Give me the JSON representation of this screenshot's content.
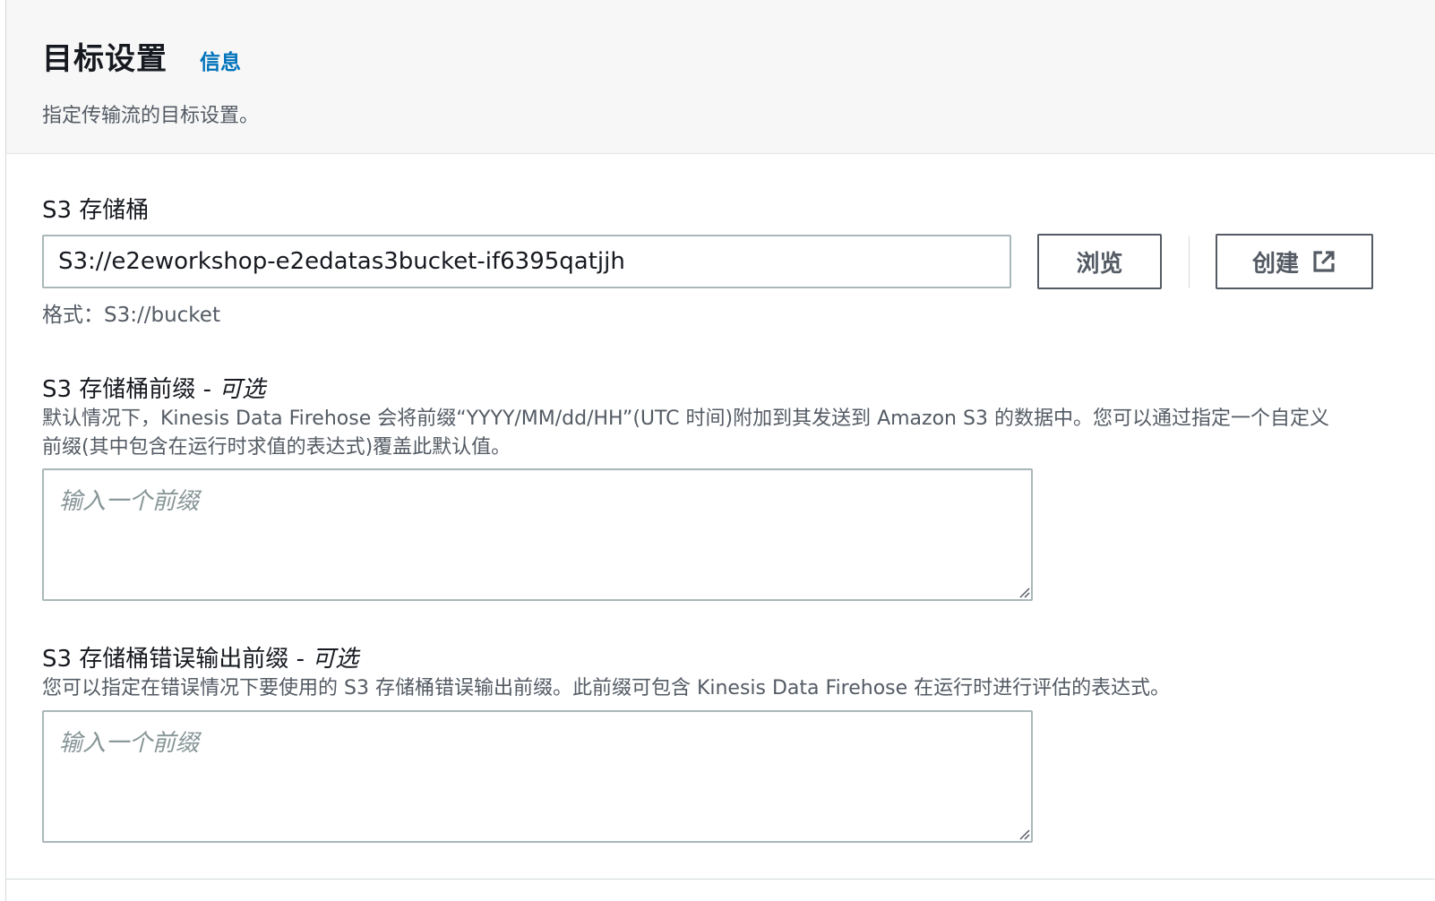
{
  "header": {
    "title": "目标设置",
    "info_link": "信息",
    "description": "指定传输流的目标设置。"
  },
  "bucket": {
    "label": "S3 存储桶",
    "value": "S3://e2eworkshop-e2edatas3bucket-if6395qatjjh",
    "browse_label": "浏览",
    "create_label": "创建",
    "create_icon": "external-link-icon",
    "format_hint": "格式：S3://bucket"
  },
  "prefix": {
    "label": "S3 存储桶前缀 - ",
    "optional": "可选",
    "help_line1": "默认情况下，Kinesis Data Firehose 会将前缀“YYYY/MM/dd/HH”(UTC 时间)附加到其发送到 Amazon S3 的数据中。您可以通过指定一个自定义",
    "help_line2": "前缀(其中包含在运行时求值的表达式)覆盖此默认值。",
    "placeholder": "输入一个前缀"
  },
  "error_prefix": {
    "label": "S3 存储桶错误输出前缀 - ",
    "optional": "可选",
    "help": "您可以指定在错误情况下要使用的 S3 存储桶错误输出前缀。此前缀可包含 Kinesis Data Firehose 在运行时进行评估的表达式。",
    "placeholder": "输入一个前缀"
  }
}
